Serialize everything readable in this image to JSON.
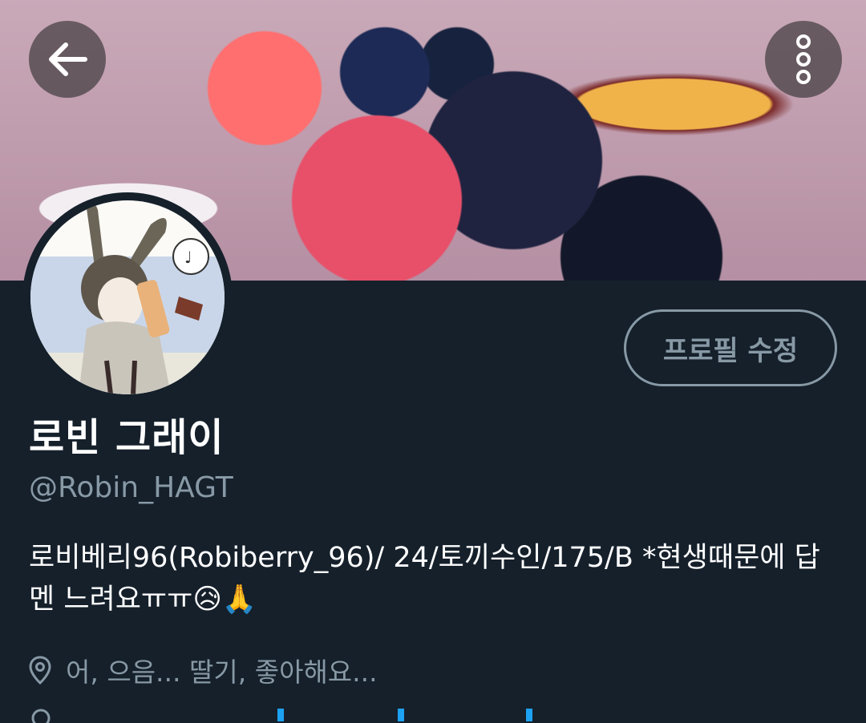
{
  "profile": {
    "display_name": "로빈 그래이",
    "handle": "@Robin_HAGT",
    "bio": "로비베리96(Robiberry_96)/ 24/토끼수인/175/B *현생때문에 답멘 느려요ㅠㅠ😥🙏",
    "location": "어, 으음... 딸기, 좋아해요..."
  },
  "header": {
    "back_icon": "arrow-left-icon",
    "more_icon": "more-vertical-icon"
  },
  "actions": {
    "edit_profile_label": "프로필 수정"
  },
  "colors": {
    "background": "#15202b",
    "secondary_text": "#8899a6",
    "primary_text": "#ffffff"
  }
}
